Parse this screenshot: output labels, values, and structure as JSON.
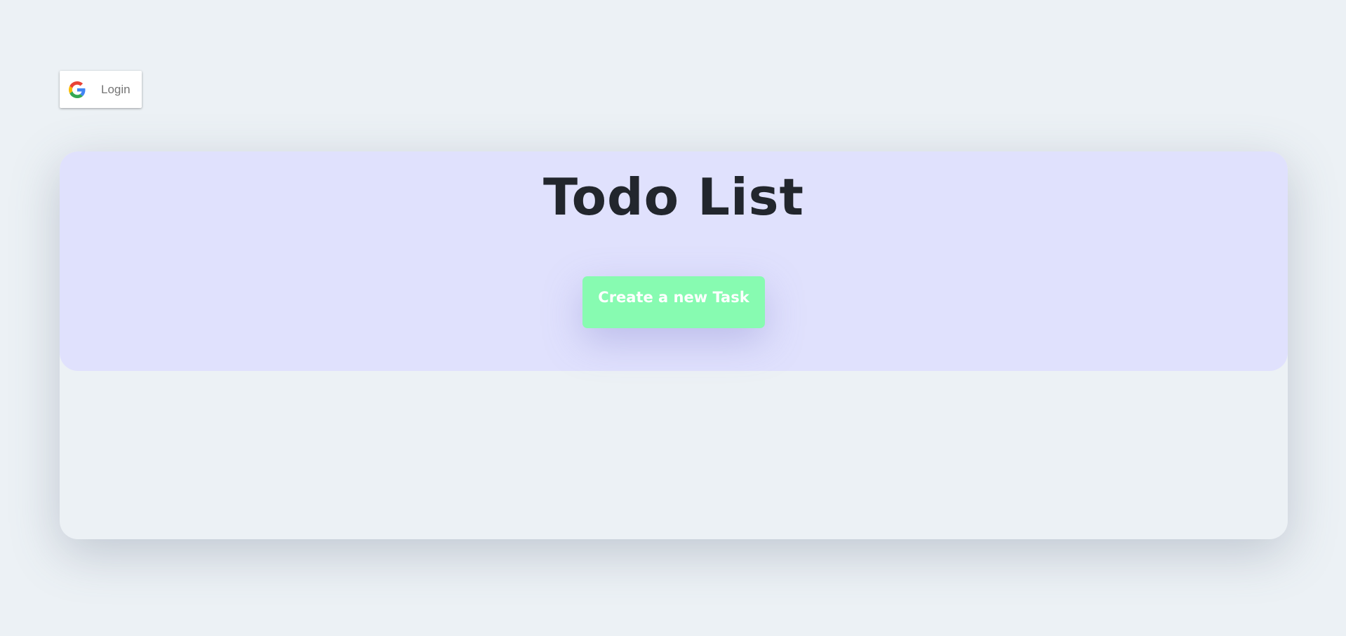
{
  "login": {
    "label": "Login",
    "icon": "google-icon"
  },
  "header": {
    "title": "Todo List"
  },
  "actions": {
    "create_label": "Create a new Task"
  },
  "colors": {
    "background": "#ecf1f5",
    "header_background": "#e0e1fd",
    "create_button": "#87fbb1",
    "title_text": "#22262d"
  }
}
